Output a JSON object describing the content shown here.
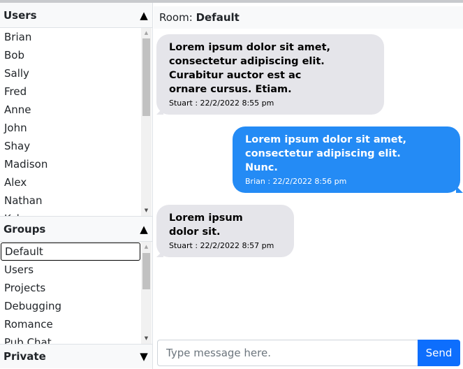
{
  "sidebar": {
    "users": {
      "title": "Users",
      "toggle_icon": "triangle-up",
      "items": [
        "Brian",
        "Bob",
        "Sally",
        "Fred",
        "Anne",
        "John",
        "Shay",
        "Madison",
        "Alex",
        "Nathan",
        "Kyle"
      ]
    },
    "groups": {
      "title": "Groups",
      "toggle_icon": "triangle-up",
      "selected": "Default",
      "items": [
        "Default",
        "Users",
        "Projects",
        "Debugging",
        "Romance",
        "Pub Chat"
      ]
    },
    "private": {
      "title": "Private",
      "toggle_icon": "triangle-down"
    }
  },
  "room": {
    "label": "Room:",
    "name": "Default"
  },
  "messages": [
    {
      "direction": "incoming",
      "text": "Lorem ipsum dolor sit amet,\nconsectetur adipiscing elit.\nCurabitur auctor est ac\nornare cursus. Etiam.",
      "meta": "Stuart : 22/2/2022 8:55 pm"
    },
    {
      "direction": "outgoing",
      "text": "Lorem ipsum dolor sit amet,\nconsectetur adipiscing elit.\nNunc.",
      "meta": "Brian : 22/2/2022 8:56 pm"
    },
    {
      "direction": "incoming",
      "text": "Lorem ipsum\ndolor sit.",
      "meta": "Stuart : 22/2/2022 8:57 pm"
    }
  ],
  "composer": {
    "placeholder": "Type message here.",
    "value": "",
    "send_label": "Send"
  },
  "colors": {
    "incoming_bubble": "#e5e5ea",
    "outgoing_bubble": "#248bf5",
    "send_button": "#0d6efd"
  }
}
